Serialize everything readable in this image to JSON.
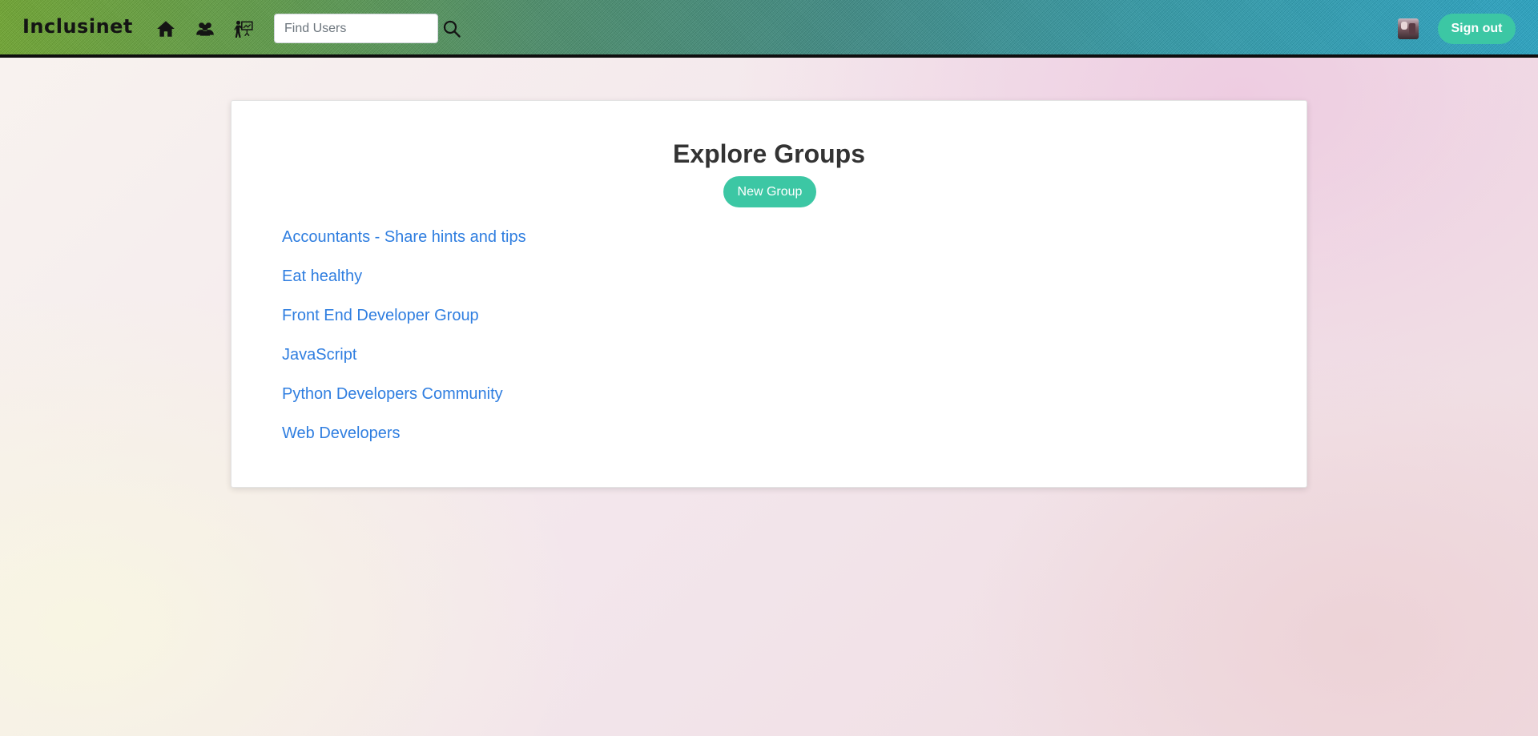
{
  "header": {
    "brand": "Inclusinet",
    "nav_icons": [
      "home-icon",
      "groups-icon",
      "presentation-icon"
    ],
    "search": {
      "placeholder": "Find Users",
      "value": "",
      "button_icon": "search-icon"
    },
    "avatar_icon": "user-avatar",
    "signout_label": "Sign out"
  },
  "main": {
    "title": "Explore Groups",
    "new_group_label": "New Group",
    "groups": [
      {
        "name": "Accountants - Share hints and tips"
      },
      {
        "name": "Eat healthy"
      },
      {
        "name": "Front End Developer Group"
      },
      {
        "name": "JavaScript"
      },
      {
        "name": "Python Developers Community"
      },
      {
        "name": "Web Developers"
      }
    ]
  },
  "colors": {
    "accent": "#3cc7a4",
    "link": "#2f7ee0",
    "title": "#333333",
    "header_border": "#0f0f0f"
  }
}
